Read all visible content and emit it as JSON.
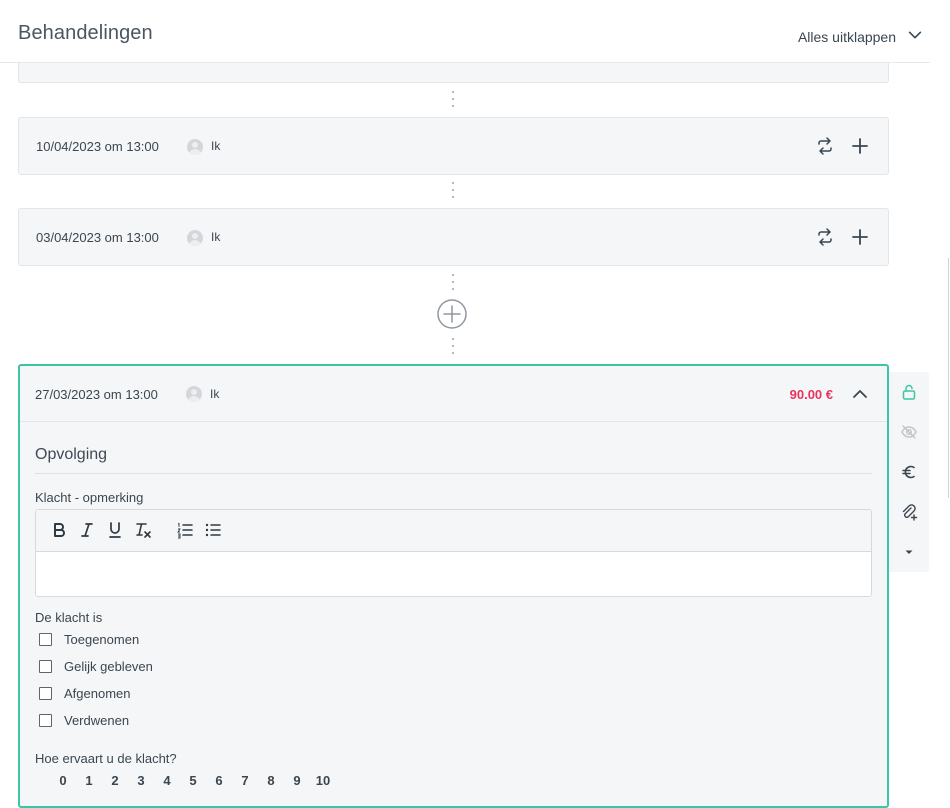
{
  "header": {
    "title": "Behandelingen",
    "expand_all_label": "Alles uitklappen"
  },
  "treatments": [
    {
      "date": "10/04/2023 om 13:00",
      "user": "Ik"
    },
    {
      "date": "03/04/2023 om 13:00",
      "user": "Ik"
    }
  ],
  "open_treatment": {
    "date": "27/03/2023 om 13:00",
    "user": "Ik",
    "price": "90.00 €",
    "section_title": "Opvolging",
    "complaint_label": "Klacht - opmerking",
    "complaint_value": "",
    "status_label": "De klacht is",
    "status_options": [
      {
        "label": "Toegenomen",
        "checked": false
      },
      {
        "label": "Gelijk gebleven",
        "checked": false
      },
      {
        "label": "Afgenomen",
        "checked": false
      },
      {
        "label": "Verdwenen",
        "checked": false
      }
    ],
    "experience_label": "Hoe ervaart u de klacht?",
    "scale": [
      "0",
      "1",
      "2",
      "3",
      "4",
      "5",
      "6",
      "7",
      "8",
      "9",
      "10"
    ]
  },
  "colors": {
    "accent": "#3cc6a3",
    "price": "#e8325e",
    "card_bg": "#f5f6f7",
    "text": "#3a4650"
  },
  "icons": {
    "expand_all": "chevron-down-icon",
    "repeat": "repeat-icon",
    "add": "plus-icon",
    "add_treatment": "plus-circle-icon",
    "collapse": "chevron-up-icon",
    "lock": "unlock-icon",
    "visibility": "eye-off-icon",
    "billing": "euro-icon",
    "attach": "paperclip-plus-icon",
    "more": "caret-down-icon"
  }
}
